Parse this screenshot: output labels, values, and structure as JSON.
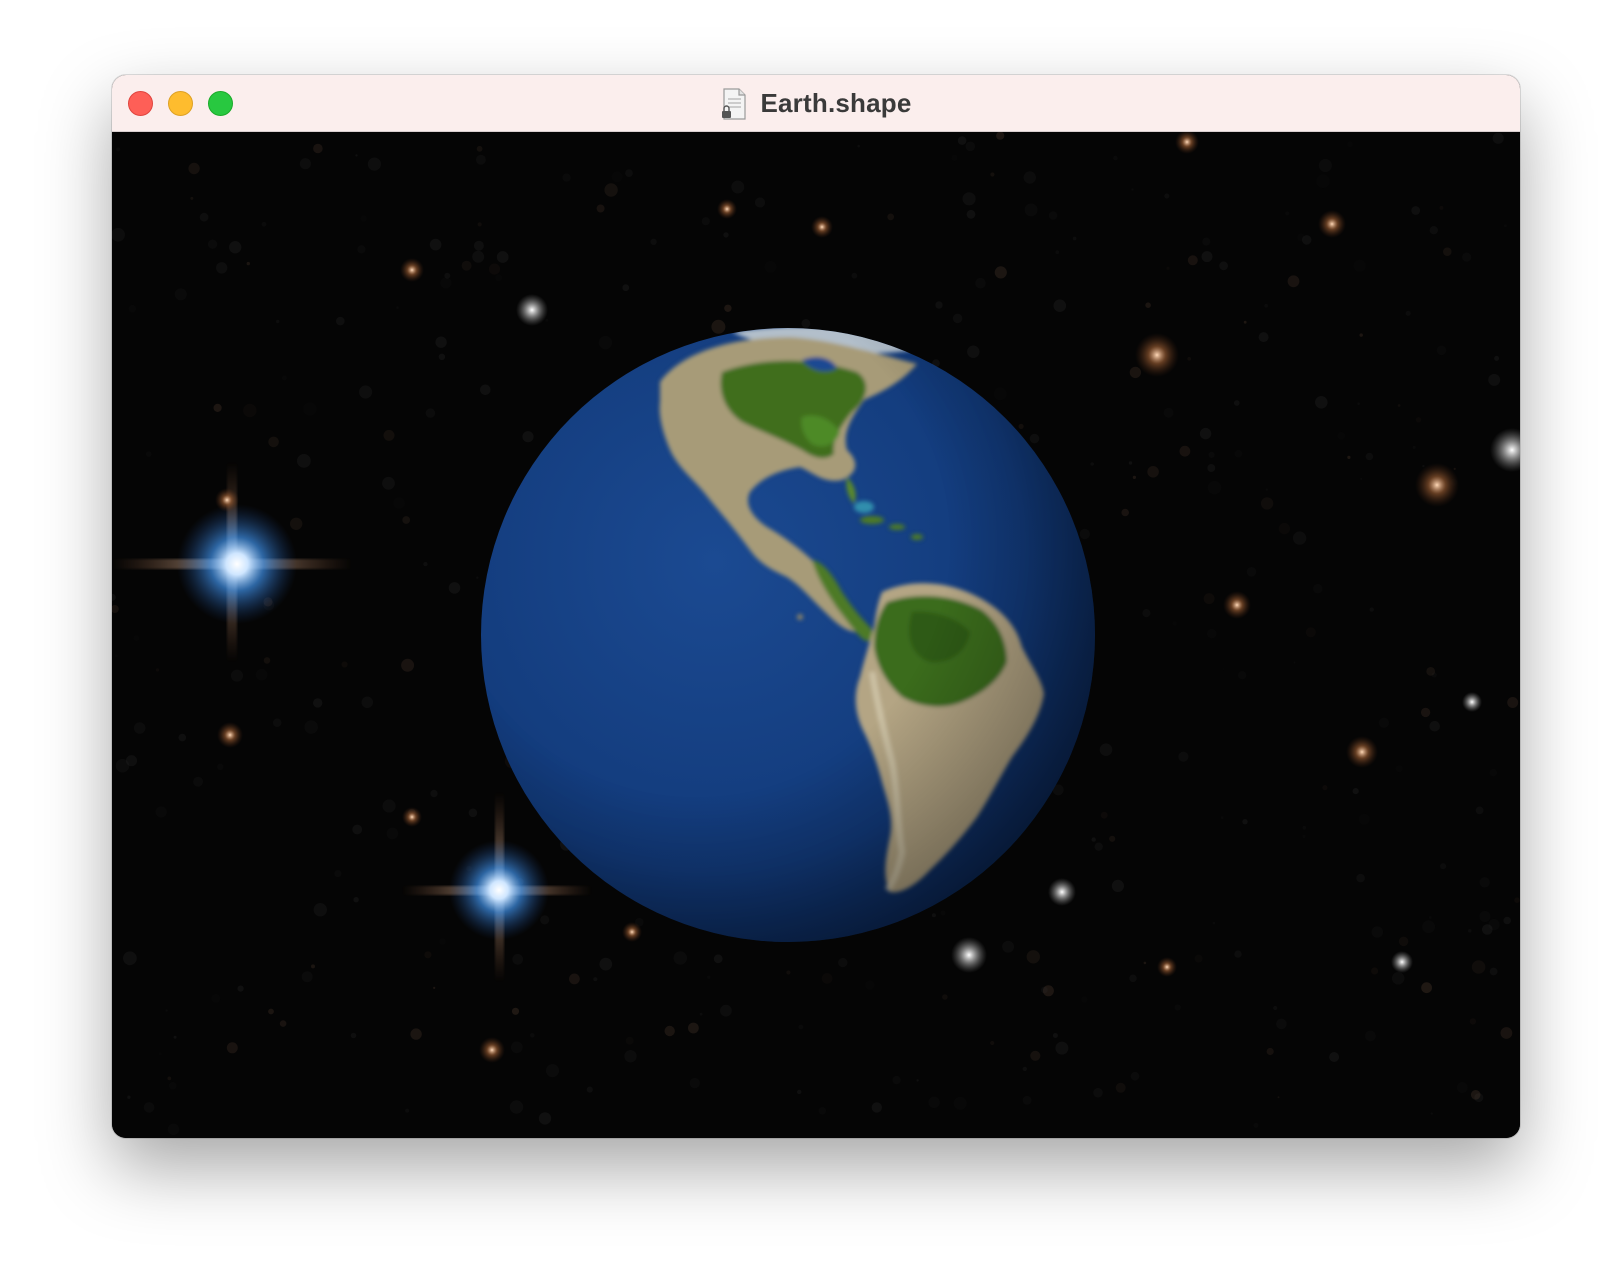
{
  "window": {
    "title": "Earth.shape",
    "title_icon": "document-lock-icon"
  },
  "traffic_lights": {
    "close": {
      "icon": "close-icon",
      "color": "#fe5f57"
    },
    "minimize": {
      "icon": "minimize-icon",
      "color": "#febc2e"
    },
    "zoom": {
      "icon": "zoom-icon",
      "color": "#28c840"
    }
  },
  "scene": {
    "subject": "earth-globe",
    "background": "starfield",
    "ocean_color": "#123a7a",
    "land_colors": [
      "#3f6e1e",
      "#b9a887",
      "#5b8a2c"
    ]
  }
}
